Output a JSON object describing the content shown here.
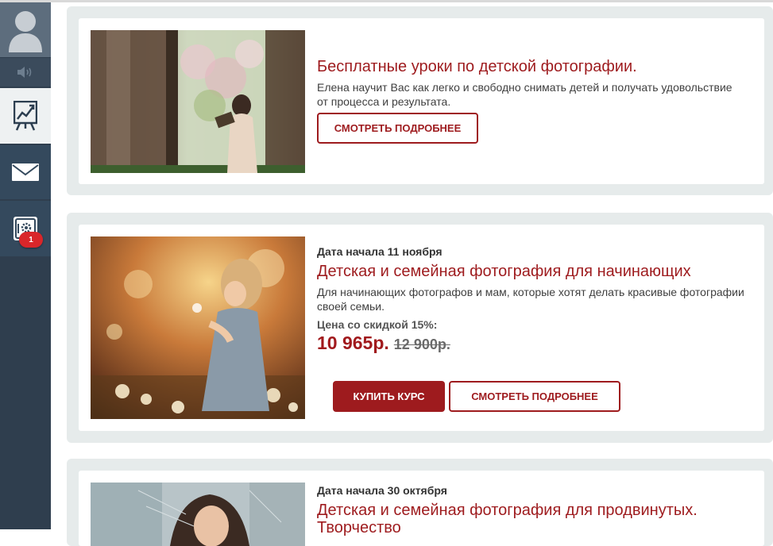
{
  "sidebar": {
    "avatar_icon": "user-avatar-icon",
    "sound_icon": "speaker-icon",
    "items": [
      {
        "icon": "chart-board-icon",
        "active": true
      },
      {
        "icon": "mail-icon",
        "active": false
      },
      {
        "icon": "settings-gear-icon",
        "active": false,
        "badge": "1"
      }
    ]
  },
  "cards": [
    {
      "title": "Бесплатные уроки по детской фотографии.",
      "description": "Елена научит Вас как легко и свободно снимать детей и получать удовольствие от процесса и результата.",
      "more_label": "СМОТРЕТЬ ПОДРОБНЕЕ"
    },
    {
      "date": "Дата начала 11 ноября",
      "title": "Детская и семейная фотография для начинающих",
      "description": "Для начинающих фотографов и мам, которые хотят делать красивые фотографии своей семьи.",
      "price_label": "Цена со скидкой 15%:",
      "price": "10 965р.",
      "old_price": "12 900р.",
      "buy_label": "КУПИТЬ КУРС",
      "more_label": "СМОТРЕТЬ ПОДРОБНЕЕ"
    },
    {
      "date": "Дата начала 30 октября",
      "title": "Детская и семейная фотография для продвинутых. Творчество"
    }
  ],
  "colors": {
    "accent": "#9e1b1e",
    "sidebar": "#2f3e4e",
    "card_bg": "#e6ebeb",
    "badge": "#d9262a"
  }
}
